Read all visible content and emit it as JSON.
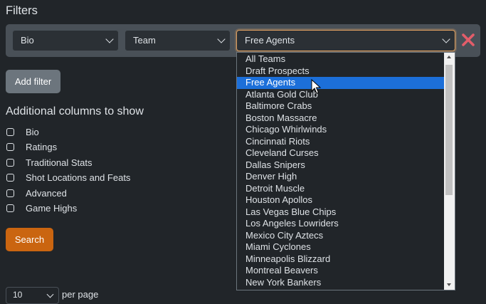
{
  "heading": "Filters",
  "filters": {
    "category_select": "Bio",
    "field_select": "Team",
    "value_select": "Free Agents"
  },
  "add_filter_label": "Add filter",
  "columns": {
    "heading": "Additional columns to show",
    "items": [
      "Bio",
      "Ratings",
      "Traditional Stats",
      "Shot Locations and Feats",
      "Advanced",
      "Game Highs"
    ]
  },
  "search_label": "Search",
  "pagination": {
    "per_page_value": "10",
    "per_page_label": "per page"
  },
  "dropdown": {
    "selected_index": 2,
    "options": [
      "All Teams",
      "Draft Prospects",
      "Free Agents",
      "Atlanta Gold Club",
      "Baltimore Crabs",
      "Boston Massacre",
      "Chicago Whirlwinds",
      "Cincinnati Riots",
      "Cleveland Curses",
      "Dallas Snipers",
      "Denver High",
      "Detroit Muscle",
      "Houston Apollos",
      "Las Vegas Blue Chips",
      "Los Angeles Lowriders",
      "Mexico City Aztecs",
      "Miami Cyclones",
      "Minneapolis Blizzard",
      "Montreal Beavers",
      "New York Bankers"
    ]
  },
  "colors": {
    "background": "#212529",
    "accent": "#ca6510",
    "selection": "#1c6fd9",
    "remove": "#e35d6a"
  },
  "icons": {
    "remove": "close-x-icon",
    "cursor": "mouse-pointer-icon"
  }
}
